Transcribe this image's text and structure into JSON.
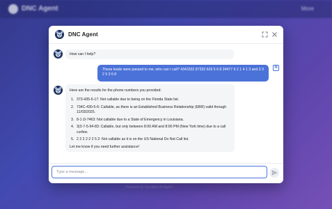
{
  "background": {
    "app_title": "DNC Agent",
    "menu_label": "More",
    "footer_text": "Powered by Sendbird AI Agent"
  },
  "dialog": {
    "title": "DNC Agent",
    "accent_color": "#4b72d8"
  },
  "messages": {
    "greeting": "How can I help?",
    "user_query": "These leads were passed to me, who can I call? 4343332 87332 626 5 6 8 24477 6 2 1 4 1 3 and 3 3 2 5 3 6 8",
    "user_badge": "N",
    "results_intro": "Here are the results for the phone numbers you provided:",
    "results": [
      {
        "num": "1.",
        "text": "373-435-6-17: Not callable due to being on the Florida State list."
      },
      {
        "num": "2.",
        "text": "734C-430-5-6: Callable, as there is an Established Business Relationship (EBR) valid through 11/03/2025."
      },
      {
        "num": "3.",
        "text": "8-1 i3-7463: Not callable due to a State of Emergency in Louisiana."
      },
      {
        "num": "4.",
        "text": "3(3-7-5-94-83: Callable, but only between 8:00 AM and 8:00 PM (New York time) due to a call curfew."
      },
      {
        "num": "5.",
        "text": "2 2 2 2 2 2 5 2: Not callable as it is on the US National Do Not Call list."
      }
    ],
    "closing": "Let me know if you need further assistance!"
  },
  "composer": {
    "placeholder": "Type a message..."
  }
}
